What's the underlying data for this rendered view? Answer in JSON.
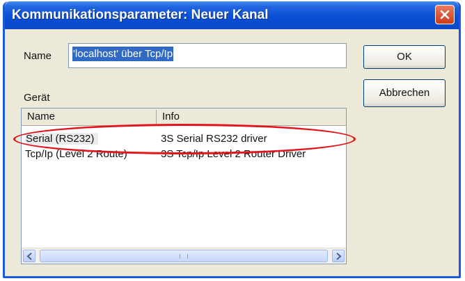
{
  "dialog": {
    "title": "Kommunikationsparameter: Neuer Kanal",
    "name_label": "Name",
    "name_value": "'localhost' über Tcp/Ip",
    "ok_label": "OK",
    "cancel_label": "Abbrechen",
    "device_group_label": "Gerät"
  },
  "device_list": {
    "columns": [
      "Name",
      "Info"
    ],
    "rows": [
      {
        "name": "Serial (RS232)",
        "info": "3S Serial RS232 driver",
        "highlighted": true
      },
      {
        "name": "Tcp/Ip (Level 2 Route)",
        "info": "3S Tcp/Ip Level 2 Router Driver",
        "highlighted": false
      }
    ]
  },
  "colors": {
    "title_bar": "#0a4fd6",
    "selection": "#316ac5",
    "highlight_ring": "#e2141c",
    "dialog_face": "#ece9d8"
  },
  "icons": [
    "close-icon",
    "scroll-left-icon",
    "scroll-right-icon"
  ]
}
